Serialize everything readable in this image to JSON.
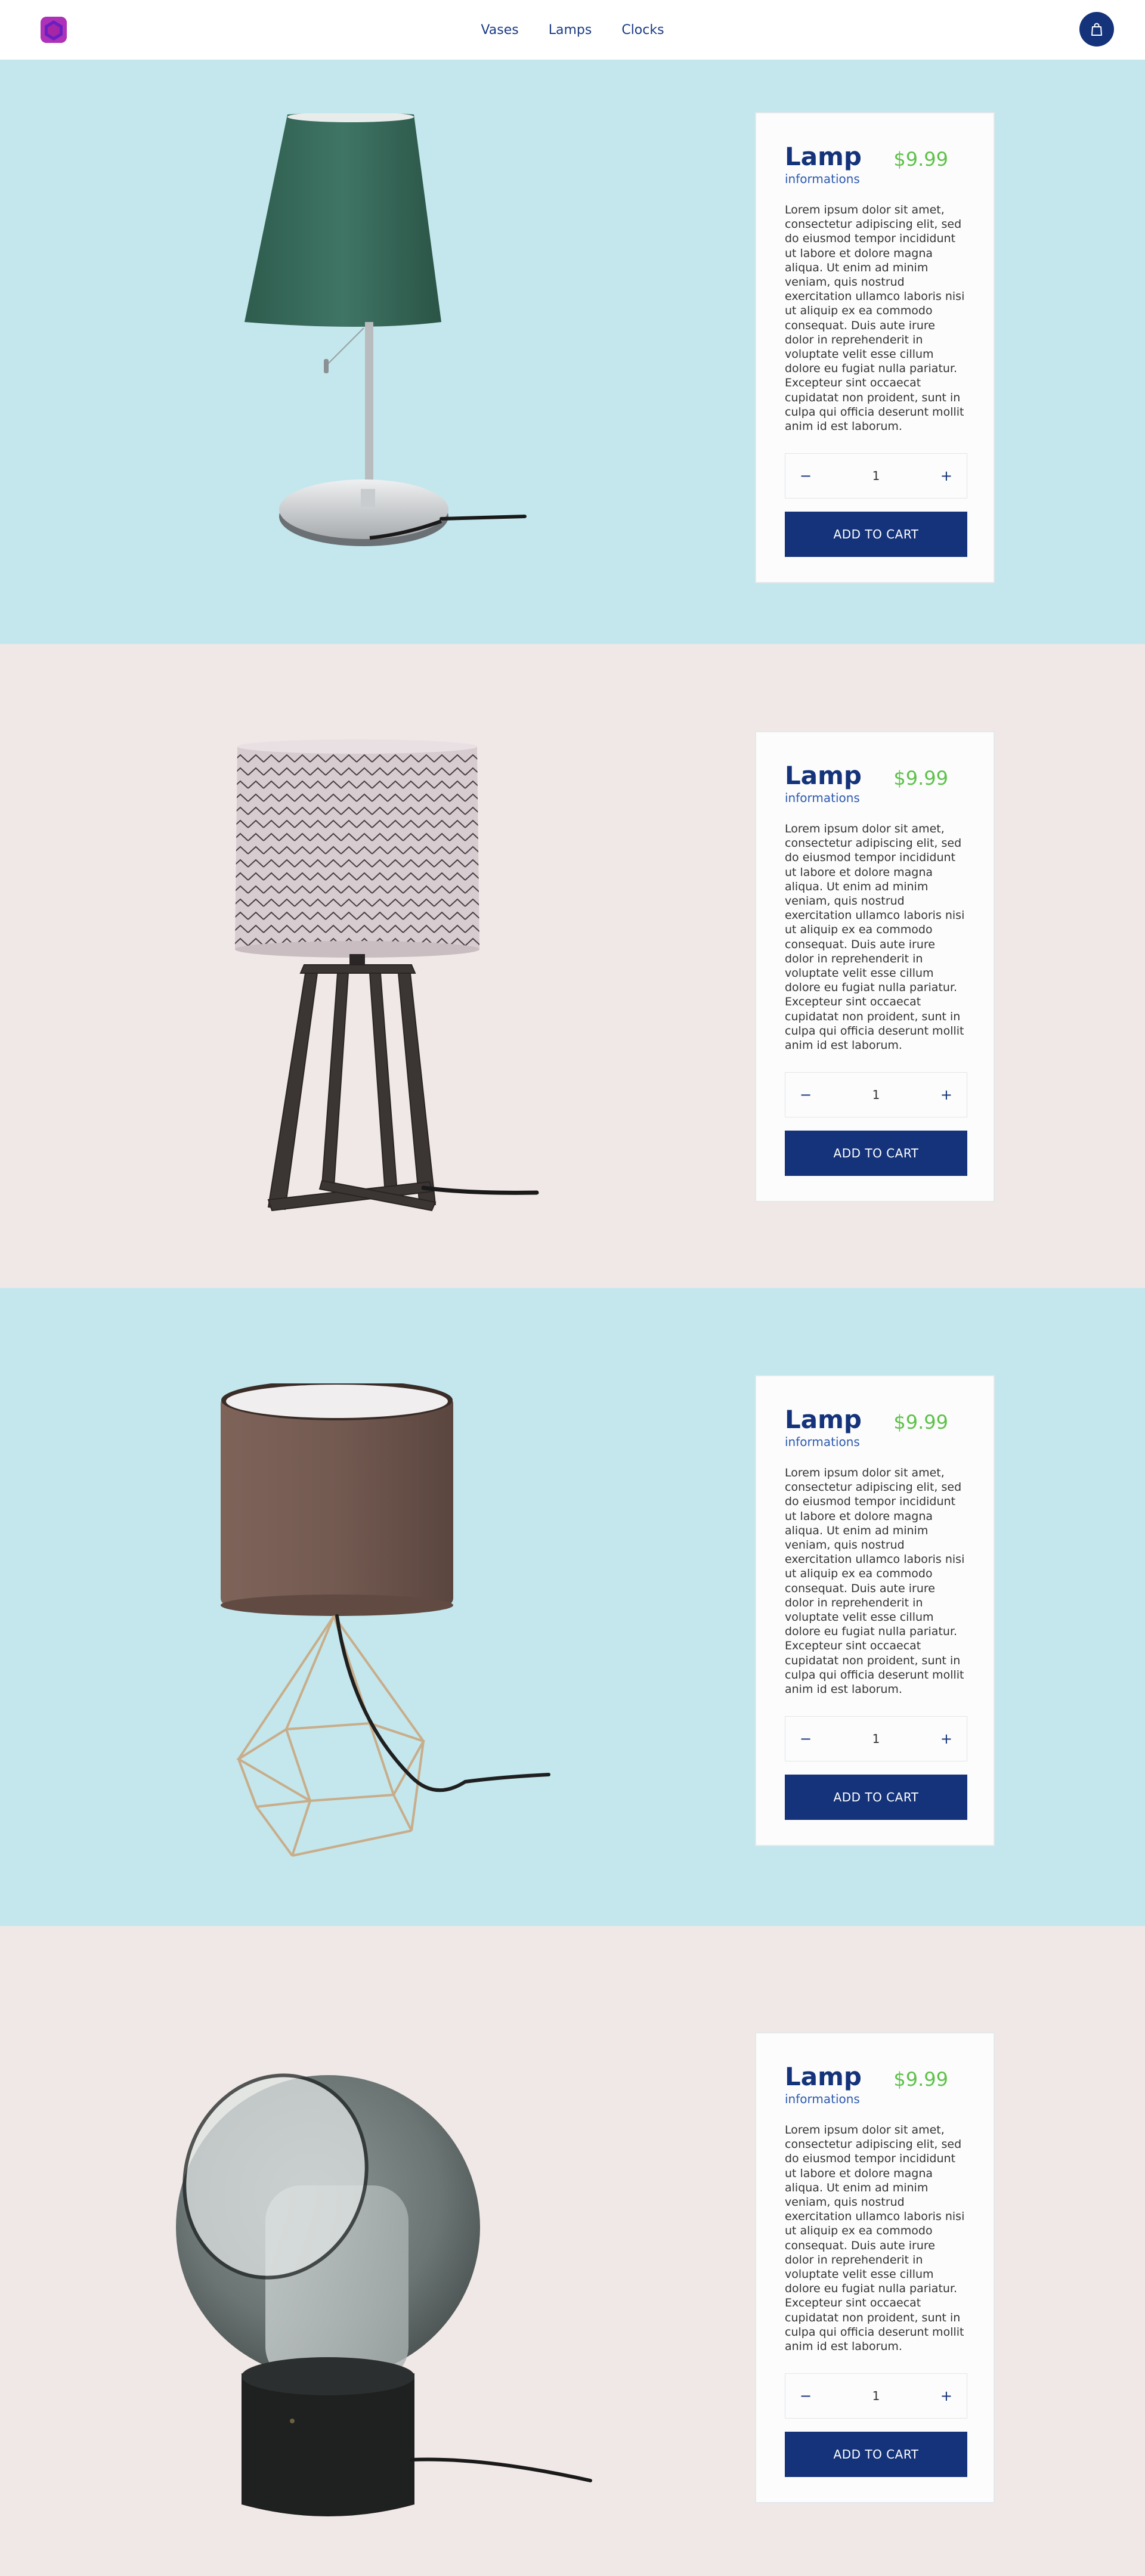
{
  "nav": {
    "links": [
      "Vases",
      "Lamps",
      "Clocks"
    ]
  },
  "icons": {
    "logo": "brand-logo-icon",
    "cart": "shopping-bag-icon"
  },
  "colors": {
    "primary": "#14337a",
    "price": "#5ec24a",
    "section_blue": "#c3e7ed",
    "section_pink": "#f0e8e6"
  },
  "products": [
    {
      "title": "Lamp",
      "subtitle": "informations",
      "price": "$9.99",
      "description": "Lorem ipsum dolor sit amet, consectetur adipiscing elit, sed do eiusmod tempor incididunt ut labore et dolore magna aliqua. Ut enim ad minim veniam, quis nostrud exercitation ullamco laboris nisi ut aliquip ex ea commodo consequat. Duis aute irure dolor in reprehenderit in voluptate velit esse cillum dolore eu fugiat nulla pariatur. Excepteur sint occaecat cupidatat non proident, sunt in culpa qui officia deserunt mollit anim id est laborum.",
      "minus": "−",
      "quantity": "1",
      "plus": "+",
      "add_label": "ADD TO CART"
    },
    {
      "title": "Lamp",
      "subtitle": "informations",
      "price": "$9.99",
      "description": "Lorem ipsum dolor sit amet, consectetur adipiscing elit, sed do eiusmod tempor incididunt ut labore et dolore magna aliqua. Ut enim ad minim veniam, quis nostrud exercitation ullamco laboris nisi ut aliquip ex ea commodo consequat. Duis aute irure dolor in reprehenderit in voluptate velit esse cillum dolore eu fugiat nulla pariatur. Excepteur sint occaecat cupidatat non proident, sunt in culpa qui officia deserunt mollit anim id est laborum.",
      "minus": "−",
      "quantity": "1",
      "plus": "+",
      "add_label": "ADD TO CART"
    },
    {
      "title": "Lamp",
      "subtitle": "informations",
      "price": "$9.99",
      "description": "Lorem ipsum dolor sit amet, consectetur adipiscing elit, sed do eiusmod tempor incididunt ut labore et dolore magna aliqua. Ut enim ad minim veniam, quis nostrud exercitation ullamco laboris nisi ut aliquip ex ea commodo consequat. Duis aute irure dolor in reprehenderit in voluptate velit esse cillum dolore eu fugiat nulla pariatur. Excepteur sint occaecat cupidatat non proident, sunt in culpa qui officia deserunt mollit anim id est laborum.",
      "minus": "−",
      "quantity": "1",
      "plus": "+",
      "add_label": "ADD TO CART"
    },
    {
      "title": "Lamp",
      "subtitle": "informations",
      "price": "$9.99",
      "description": "Lorem ipsum dolor sit amet, consectetur adipiscing elit, sed do eiusmod tempor incididunt ut labore et dolore magna aliqua. Ut enim ad minim veniam, quis nostrud exercitation ullamco laboris nisi ut aliquip ex ea commodo consequat. Duis aute irure dolor in reprehenderit in voluptate velit esse cillum dolore eu fugiat nulla pariatur. Excepteur sint occaecat cupidatat non proident, sunt in culpa qui officia deserunt mollit anim id est laborum.",
      "minus": "−",
      "quantity": "1",
      "plus": "+",
      "add_label": "ADD TO CART"
    }
  ]
}
